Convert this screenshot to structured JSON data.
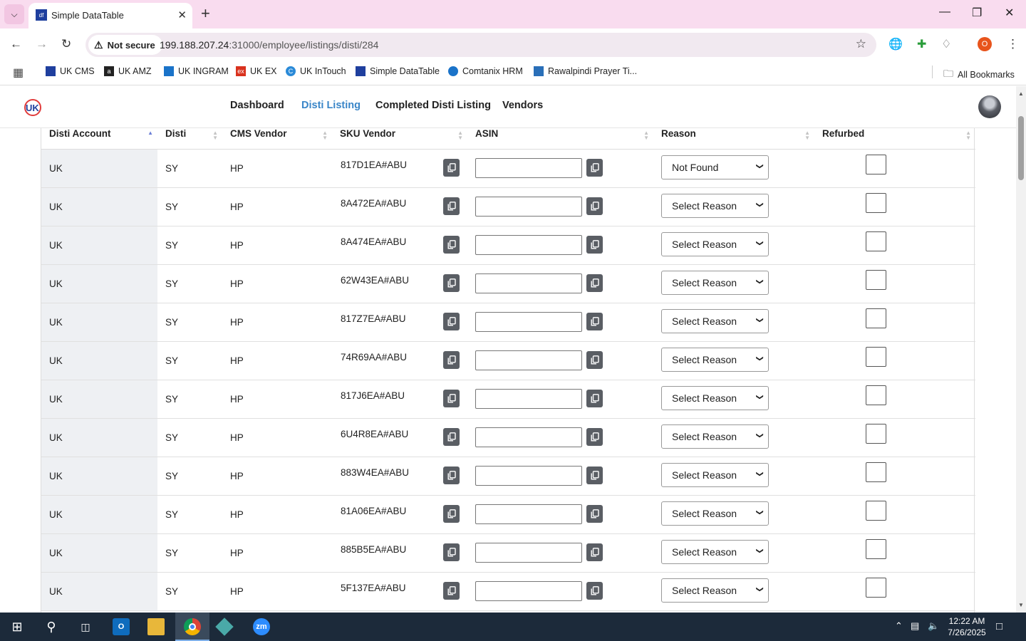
{
  "browser": {
    "tab_title": "Simple DataTable",
    "tab_favicon": "df",
    "url_host": "199.188.207.24",
    "url_path": ":31000/employee/listings/disti/284",
    "security_label": "Not secure",
    "profile_initial": "O",
    "bookmarks": [
      {
        "label": "UK CMS",
        "icon_color": "#1f3f9e"
      },
      {
        "label": "UK AMZ",
        "icon_color": "#222222"
      },
      {
        "label": "UK INGRAM",
        "icon_color": "#1a73c9"
      },
      {
        "label": "UK EX",
        "icon_color": "#d9321e"
      },
      {
        "label": "UK InTouch",
        "icon_color": "#2a8ad8"
      },
      {
        "label": "Simple DataTable",
        "icon_color": "#1f3f9e"
      },
      {
        "label": "Comtanix HRM",
        "icon_color": "#1a73c9"
      },
      {
        "label": "Rawalpindi Prayer Ti...",
        "icon_color": "#2a6fb8"
      }
    ],
    "all_bookmarks_label": "All Bookmarks"
  },
  "site": {
    "nav": [
      "Dashboard",
      "Disti Listing",
      "Completed Disti Listing",
      "Vendors"
    ],
    "active_nav": "Disti Listing",
    "accent_color": "#3a86c8"
  },
  "table": {
    "columns": [
      "Disti Account",
      "Disti",
      "CMS Vendor",
      "SKU Vendor",
      "ASIN",
      "Reason",
      "Refurbed"
    ],
    "sorted_column": "Disti Account",
    "sort_direction": "ascending",
    "rows": [
      {
        "account": "UK",
        "disti": "SY",
        "cms_vendor": "HP",
        "sku": "817D1EA#ABU",
        "asin": "",
        "reason": "Not Found",
        "refurbed": false
      },
      {
        "account": "UK",
        "disti": "SY",
        "cms_vendor": "HP",
        "sku": "8A472EA#ABU",
        "asin": "",
        "reason": "Select Reason",
        "refurbed": false
      },
      {
        "account": "UK",
        "disti": "SY",
        "cms_vendor": "HP",
        "sku": "8A474EA#ABU",
        "asin": "",
        "reason": "Select Reason",
        "refurbed": false
      },
      {
        "account": "UK",
        "disti": "SY",
        "cms_vendor": "HP",
        "sku": "62W43EA#ABU",
        "asin": "",
        "reason": "Select Reason",
        "refurbed": false
      },
      {
        "account": "UK",
        "disti": "SY",
        "cms_vendor": "HP",
        "sku": "817Z7EA#ABU",
        "asin": "",
        "reason": "Select Reason",
        "refurbed": false
      },
      {
        "account": "UK",
        "disti": "SY",
        "cms_vendor": "HP",
        "sku": "74R69AA#ABU",
        "asin": "",
        "reason": "Select Reason",
        "refurbed": false
      },
      {
        "account": "UK",
        "disti": "SY",
        "cms_vendor": "HP",
        "sku": "817J6EA#ABU",
        "asin": "",
        "reason": "Select Reason",
        "refurbed": false
      },
      {
        "account": "UK",
        "disti": "SY",
        "cms_vendor": "HP",
        "sku": "6U4R8EA#ABU",
        "asin": "",
        "reason": "Select Reason",
        "refurbed": false
      },
      {
        "account": "UK",
        "disti": "SY",
        "cms_vendor": "HP",
        "sku": "883W4EA#ABU",
        "asin": "",
        "reason": "Select Reason",
        "refurbed": false
      },
      {
        "account": "UK",
        "disti": "SY",
        "cms_vendor": "HP",
        "sku": "81A06EA#ABU",
        "asin": "",
        "reason": "Select Reason",
        "refurbed": false
      },
      {
        "account": "UK",
        "disti": "SY",
        "cms_vendor": "HP",
        "sku": "885B5EA#ABU",
        "asin": "",
        "reason": "Select Reason",
        "refurbed": false
      },
      {
        "account": "UK",
        "disti": "SY",
        "cms_vendor": "HP",
        "sku": "5F137EA#ABU",
        "asin": "",
        "reason": "Select Reason",
        "refurbed": false
      }
    ]
  },
  "taskbar": {
    "time": "12:22 AM",
    "date": "7/26/2025",
    "chrome_badge": "0"
  }
}
